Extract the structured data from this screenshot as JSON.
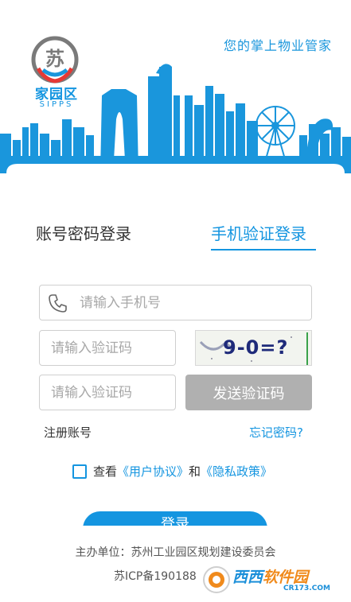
{
  "colors": {
    "accent": "#1495e0",
    "button_disabled": "#b0b0b0",
    "border": "#cfcfcf"
  },
  "header": {
    "brand_name": "家园区",
    "brand_sub": "SIPPS",
    "slogan": "您的掌上物业管家"
  },
  "tabs": [
    {
      "label": "账号密码登录",
      "active": false
    },
    {
      "label": "手机验证登录",
      "active": true
    }
  ],
  "form": {
    "phone_placeholder": "请输入手机号",
    "captcha_placeholder": "请输入验证码",
    "captcha_image_text": "9-0=?",
    "sms_code_placeholder": "请输入验证码",
    "send_code_label": "发送验证码"
  },
  "links": {
    "register": "注册账号",
    "forgot": "忘记密码?"
  },
  "agreement": {
    "prefix": "查看",
    "user_agreement": "《用户协议》",
    "and": "和",
    "privacy_policy": "《隐私政策》",
    "checked": false
  },
  "login_button": "登录",
  "footer": {
    "sponsor": "主办单位：苏州工业园区规划建设委员会",
    "icp": "苏ICP备190188"
  },
  "watermark": {
    "name_part1": "西西",
    "name_part2": "软件园",
    "url": "CR173.COM"
  },
  "icons": [
    "phone-icon",
    "checkbox-icon",
    "logo-icon"
  ]
}
